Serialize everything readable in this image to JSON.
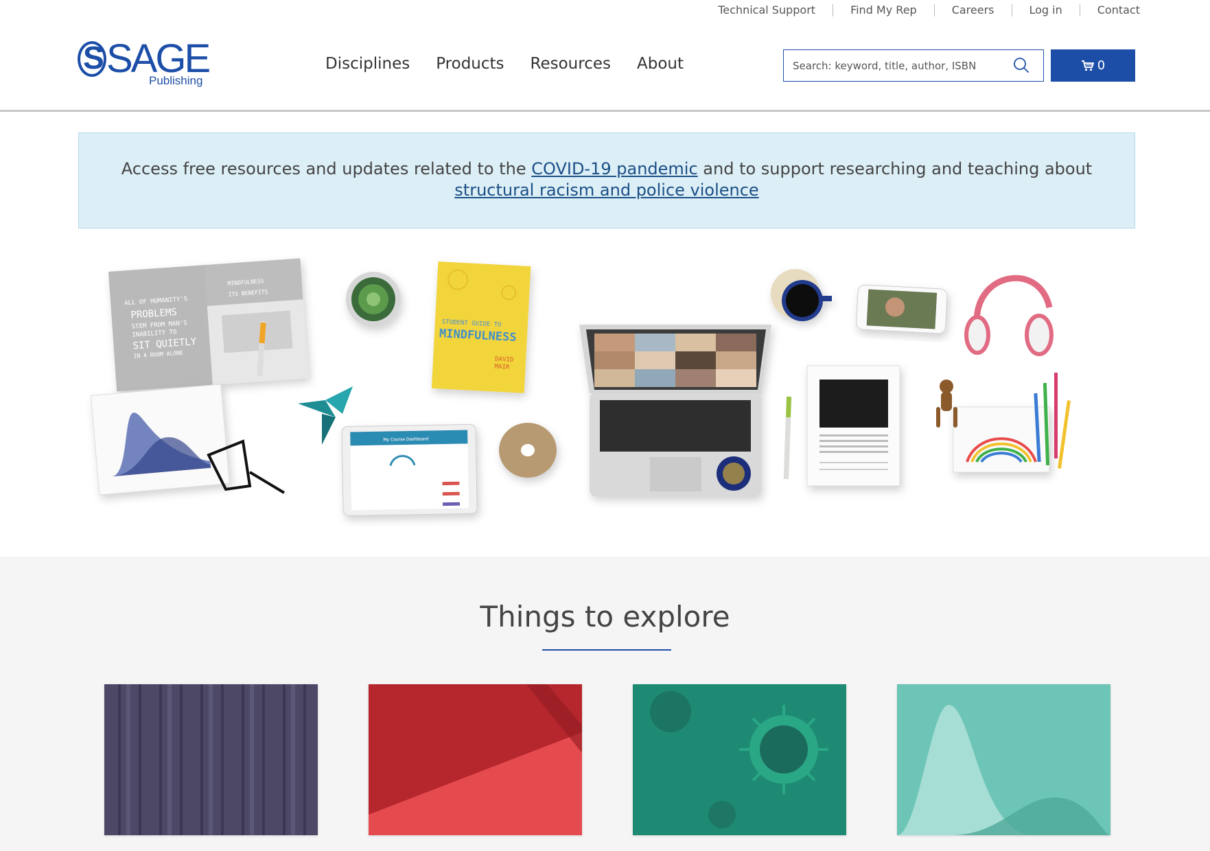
{
  "utility_nav": [
    "Technical Support",
    "Find My Rep",
    "Careers",
    "Log in",
    "Contact"
  ],
  "logo": {
    "word": "SAGE",
    "sub": "Publishing",
    "brand_color": "#1c4ea8"
  },
  "main_nav": [
    "Disciplines",
    "Products",
    "Resources",
    "About"
  ],
  "search": {
    "placeholder": "Search: keyword, title, author, ISBN"
  },
  "cart": {
    "count": "0"
  },
  "banner": {
    "text_1": "Access free resources and updates related to the ",
    "link_1": "COVID-19 pandemic",
    "text_2": " and to support researching and teaching about ",
    "link_2": "structural racism and police violence"
  },
  "hero": {
    "book_title": "MINDFULNESS",
    "book_subtitle": "STUDENT GUIDE TO",
    "book_author": "DAVID MAIR",
    "open_book_left": "ALL OF HUMANITY'S PROBLEMS STEM FROM MAN'S INABILITY TO SIT QUIETLY IN A ROOM ALONE",
    "open_book_right": "1 MINDFULNESS & ITS BENEFITS",
    "tablet_heading": "My Course Dashboard"
  },
  "explore": {
    "title": "Things to explore"
  }
}
